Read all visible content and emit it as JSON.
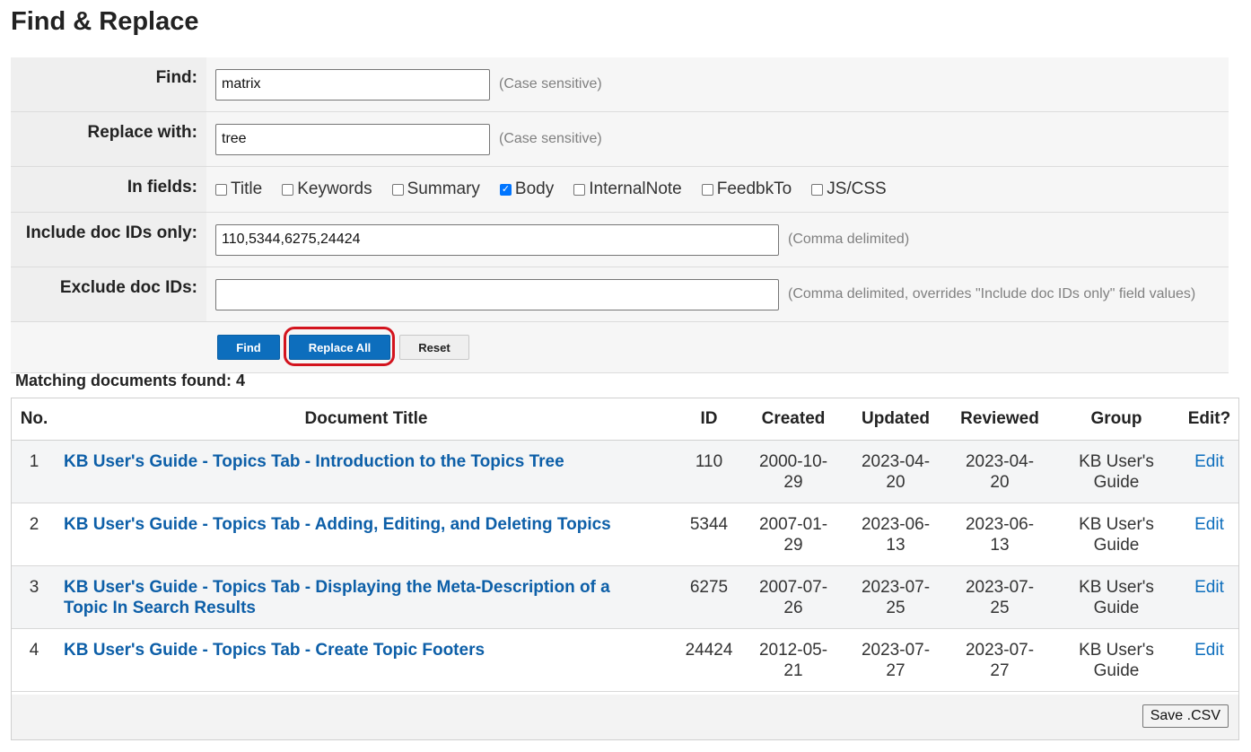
{
  "page": {
    "title": "Find & Replace"
  },
  "form": {
    "find_label": "Find:",
    "find_value": "matrix",
    "find_hint": "(Case sensitive)",
    "replace_label": "Replace with:",
    "replace_value": "tree",
    "replace_hint": "(Case sensitive)",
    "fields_label": "In fields:",
    "fields": [
      {
        "label": "Title",
        "checked": false
      },
      {
        "label": "Keywords",
        "checked": false
      },
      {
        "label": "Summary",
        "checked": false
      },
      {
        "label": "Body",
        "checked": true
      },
      {
        "label": "InternalNote",
        "checked": false
      },
      {
        "label": "FeedbkTo",
        "checked": false
      },
      {
        "label": "JS/CSS",
        "checked": false
      }
    ],
    "include_label": "Include doc IDs only:",
    "include_value": "110,5344,6275,24424",
    "include_hint": "(Comma delimited)",
    "exclude_label": "Exclude doc IDs:",
    "exclude_value": "",
    "exclude_hint": "(Comma delimited, overrides \"Include doc IDs only\" field values)"
  },
  "buttons": {
    "find": "Find",
    "replace_all": "Replace All",
    "reset": "Reset"
  },
  "results": {
    "count_text": "Matching documents found: 4",
    "columns": [
      "No.",
      "Document Title",
      "ID",
      "Created",
      "Updated",
      "Reviewed",
      "Group",
      "Edit?"
    ],
    "rows": [
      {
        "no": "1",
        "title": "KB User's Guide - Topics Tab - Introduction to the Topics Tree",
        "id": "110",
        "created": "2000-10-29",
        "updated": "2023-04-20",
        "reviewed": "2023-04-20",
        "group": "KB User's Guide",
        "edit": "Edit"
      },
      {
        "no": "2",
        "title": "KB User's Guide - Topics Tab - Adding, Editing, and Deleting Topics",
        "id": "5344",
        "created": "2007-01-29",
        "updated": "2023-06-13",
        "reviewed": "2023-06-13",
        "group": "KB User's Guide",
        "edit": "Edit"
      },
      {
        "no": "3",
        "title": "KB User's Guide - Topics Tab - Displaying the Meta-Description of a Topic In Search Results",
        "id": "6275",
        "created": "2007-07-26",
        "updated": "2023-07-25",
        "reviewed": "2023-07-25",
        "group": "KB User's Guide",
        "edit": "Edit"
      },
      {
        "no": "4",
        "title": "KB User's Guide - Topics Tab - Create Topic Footers",
        "id": "24424",
        "created": "2012-05-21",
        "updated": "2023-07-27",
        "reviewed": "2023-07-27",
        "group": "KB User's Guide",
        "edit": "Edit"
      }
    ],
    "save_csv": "Save .CSV"
  },
  "colors": {
    "accent": "#0d6ebd",
    "link": "#0d5fa8",
    "highlight_ring": "#d3141e"
  }
}
